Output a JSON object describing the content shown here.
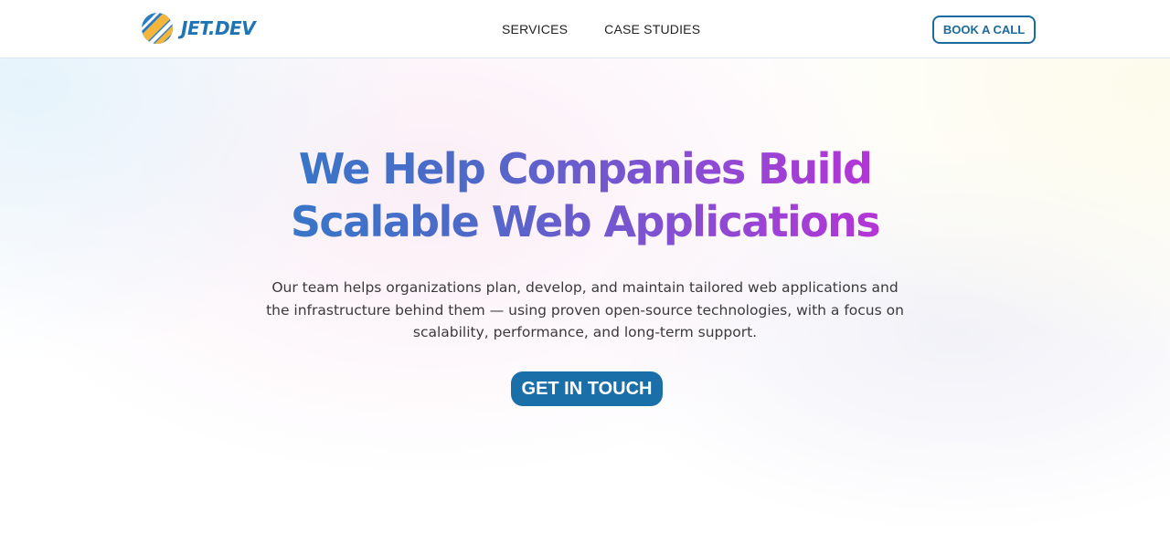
{
  "brand": {
    "name": "JET.DEV",
    "logo_icon": "jet-logo-icon",
    "color": "#1f74b4"
  },
  "nav": {
    "items": [
      {
        "label": "SERVICES"
      },
      {
        "label": "CASE STUDIES"
      }
    ]
  },
  "header": {
    "cta_label": "BOOK A CALL"
  },
  "hero": {
    "headline_line1": "We Help Companies Build",
    "headline_line2": "Scalable Web Applications",
    "subtitle": "Our team helps organizations plan, develop, and maintain tailored web applications and the infrastructure behind them — using proven open-source technologies, with a focus on scalability, performance, and long-term support.",
    "cta_label": "GET IN TOUCH"
  },
  "colors": {
    "accent": "#1a6fa8",
    "gradient_start": "#2f7bc6",
    "gradient_end": "#c62bd8"
  }
}
